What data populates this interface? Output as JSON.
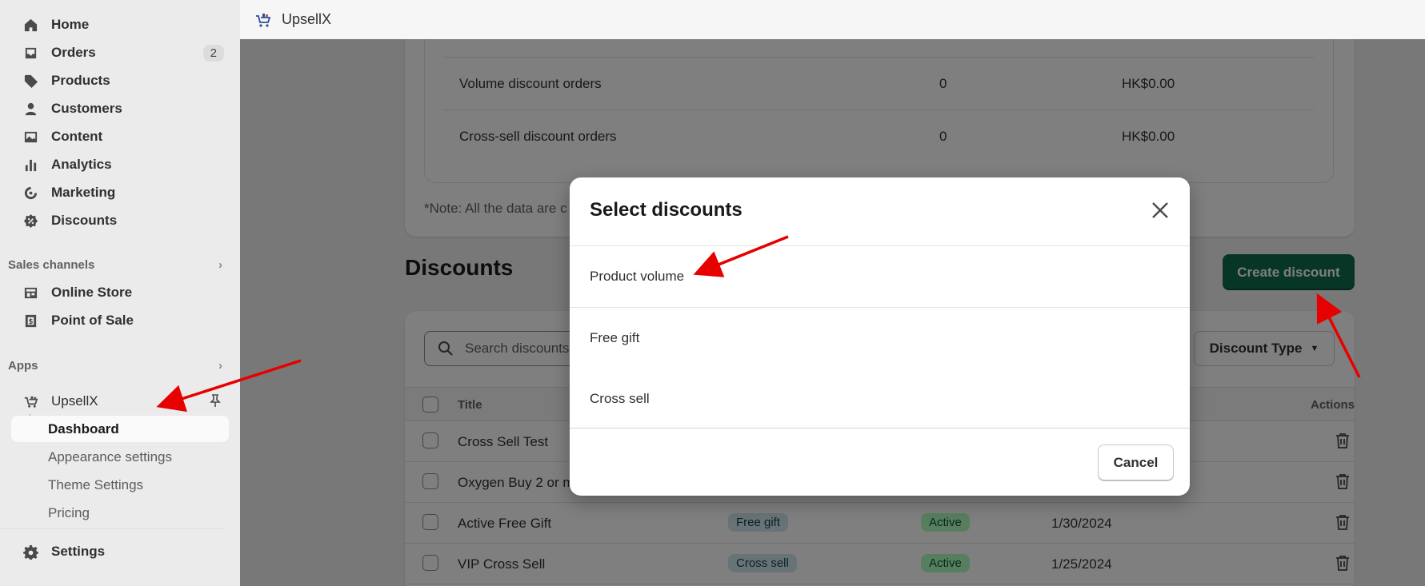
{
  "sidebar": {
    "nav": [
      {
        "label": "Home",
        "icon": "home-icon"
      },
      {
        "label": "Orders",
        "icon": "inbox-icon",
        "badge": "2"
      },
      {
        "label": "Products",
        "icon": "tag-icon"
      },
      {
        "label": "Customers",
        "icon": "person-icon"
      },
      {
        "label": "Content",
        "icon": "image-icon"
      },
      {
        "label": "Analytics",
        "icon": "bar-chart-icon"
      },
      {
        "label": "Marketing",
        "icon": "target-icon"
      },
      {
        "label": "Discounts",
        "icon": "discount-icon"
      }
    ],
    "sales_channels": {
      "title": "Sales channels",
      "items": [
        {
          "label": "Online Store",
          "icon": "store-icon"
        },
        {
          "label": "Point of Sale",
          "icon": "pos-icon"
        }
      ]
    },
    "apps": {
      "title": "Apps",
      "app_name": "UpsellX",
      "sub": [
        "Dashboard",
        "Appearance settings",
        "Theme Settings",
        "Pricing"
      ]
    },
    "settings": "Settings"
  },
  "topbar": {
    "app_name": "UpsellX"
  },
  "stats": {
    "rows": [
      {
        "label": "Volume discount orders",
        "count": "0",
        "amount": "HK$0.00"
      },
      {
        "label": "Cross-sell discount orders",
        "count": "0",
        "amount": "HK$0.00"
      }
    ],
    "note": "*Note: All the data are c"
  },
  "discounts": {
    "heading": "Discounts",
    "create_label": "Create discount",
    "search_placeholder": "Search discounts",
    "type_filter": "Discount Type",
    "columns": {
      "title": "Title",
      "actions": "Actions"
    },
    "rows": [
      {
        "title": "Cross Sell Test",
        "type": "",
        "status": "",
        "date": ""
      },
      {
        "title": "Oxygen Buy 2 or m",
        "type": "",
        "status": "",
        "date": ""
      },
      {
        "title": "Active Free Gift",
        "type": "Free gift",
        "status": "Active",
        "date": "1/30/2024"
      },
      {
        "title": "VIP Cross Sell",
        "type": "Cross sell",
        "status": "Active",
        "date": "1/25/2024"
      }
    ]
  },
  "modal": {
    "title": "Select discounts",
    "options": [
      "Product volume",
      "Free gift",
      "Cross sell"
    ],
    "cancel": "Cancel"
  },
  "colors": {
    "primary": "#0f6d4d",
    "annotation": "#e60000"
  }
}
